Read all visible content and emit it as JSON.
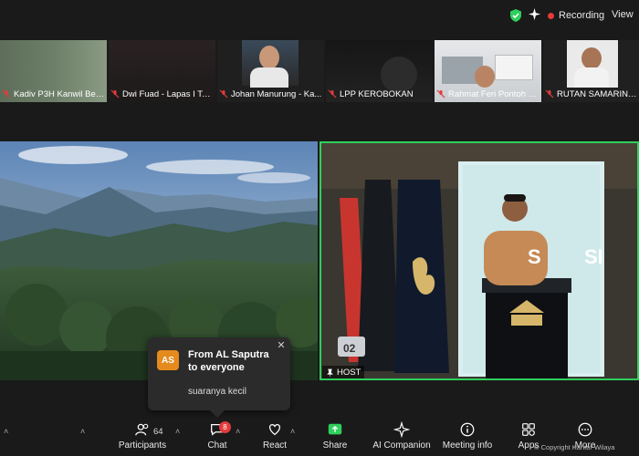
{
  "topbar": {
    "recording_label": "Recording",
    "view_label": "View"
  },
  "thumbnails": [
    {
      "name": "Kadiv P3H Kanwil Ben..."
    },
    {
      "name": "Dwi Fuad - Lapas I Tan..."
    },
    {
      "name": "Johan Manurung - Ka..."
    },
    {
      "name": "LPP KEROBOKAN"
    },
    {
      "name": "Rahmat Feri Pontoh - K..."
    },
    {
      "name": "RUTAN SAMARINDA"
    }
  ],
  "main": {
    "host_label": "HOST",
    "banner_letters": "S",
    "banner_letters2": "SI",
    "podium_number": "02"
  },
  "chat_popup": {
    "avatar_initials": "AS",
    "from_text": "From AL Saputra to everyone",
    "message": "suaranya kecil"
  },
  "toolbar": {
    "participants_label": "Participants",
    "participants_count": "64",
    "chat_label": "Chat",
    "chat_badge": "8",
    "react_label": "React",
    "share_label": "Share",
    "ai_label": "AI Companion",
    "meeting_info_label": "Meeting info",
    "apps_label": "Apps",
    "more_label": "More"
  },
  "watermark": "© Copyright Kantor Wilaya",
  "colors": {
    "host_border": "#2fcf5c",
    "share_green": "#2fcf5c",
    "badge_red": "#e23b3b",
    "avatar_orange": "#e58b1e"
  }
}
